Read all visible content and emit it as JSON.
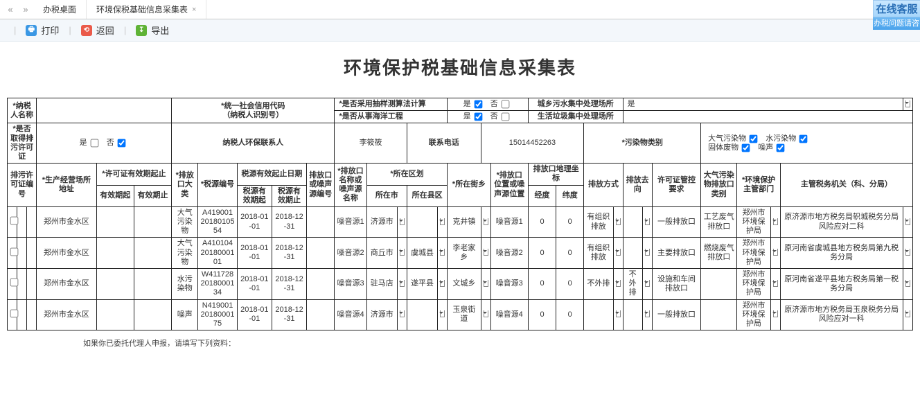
{
  "tabs": {
    "nav_left": "«",
    "nav_right": "»",
    "t0": "办税桌面",
    "t1": "环境保税基础信息采集表",
    "close": "×"
  },
  "toolbar": {
    "print": "打印",
    "back": "返回",
    "export": "导出"
  },
  "online": {
    "top": "在线客服",
    "bot": "办税问题请咨"
  },
  "title": "环境保护税基础信息采集表",
  "hdr": {
    "taxpayer_name": "*纳税人名称",
    "unified_code": "*统一社会信用代码\n（纳税人识别号）",
    "sampling": "*是否采用抽样测算法计算",
    "marine": "*是否从事海洋工程",
    "yes": "是",
    "no": "否",
    "sewage_plant": "城乡污水集中处理场所",
    "sewage_val": "是",
    "waste_plant": "生活垃圾集中处理场所",
    "has_permit": "*是否取得排污许可证",
    "contact_person": "纳税人环保联系人",
    "contact_val": "李筱筱",
    "contact_phone": "联系电话",
    "phone_val": "15014452263",
    "pollutant_cat": "*污染物类别",
    "cat_air": "大气污染物",
    "cat_water": "水污染物",
    "cat_solid": "固体废物",
    "cat_noise": "噪声"
  },
  "cols": {
    "permit_no": "排污许可证编号",
    "prod_addr": "*生产经营场所地址",
    "permit_period": "*许可证有效期起止",
    "start": "有效期起",
    "end": "有效期止",
    "outlet_cat": "*排放口大类",
    "src_no": "*税源编号",
    "src_period": "税源有效起止日期",
    "src_start": "税源有效期起",
    "src_end": "税源有效期止",
    "outlet_src_no": "排放口或噪声源编号",
    "outlet_src_name": "*排放口名称或噪声源名称",
    "region": "*所在区划",
    "city": "所在市",
    "county": "所在县区",
    "town": "*所在街乡",
    "outlet_pos": "*排放口位置或噪声源位置",
    "geo": "排放口地理坐标",
    "lon": "经度",
    "lat": "纬度",
    "mode": "排放方式",
    "dir": "排放去向",
    "permit_req": "许可证管控要求",
    "air_outlet_type": "大气污染物排放口类别",
    "env_dept": "*环境保护主管部门",
    "tax_org": "主管税务机关（科、分局）"
  },
  "rows": [
    {
      "addr": "郑州市金水区",
      "cat": "大气污染物",
      "src": "A4190012018010554",
      "s": "2018-01-01",
      "e": "2018-12-31",
      "name": "噪音源1",
      "city": "济源市",
      "county": "",
      "town": "克井镇",
      "pos": "噪音源1",
      "lon": "0",
      "lat": "0",
      "mode": "有组织排放",
      "dir": "",
      "req": "一般排放口",
      "at": "工艺废气排放口",
      "dept": "郑州市环境保护局",
      "org": "原济源市地方税务局轵城税务分局风险应对二科"
    },
    {
      "addr": "郑州市金水区",
      "cat": "大气污染物",
      "src": "A4101042018000101",
      "s": "2018-01-01",
      "e": "2018-12-31",
      "name": "噪音源2",
      "city": "商丘市",
      "county": "虞城县",
      "town": "李老家乡",
      "pos": "噪音源2",
      "lon": "0",
      "lat": "0",
      "mode": "有组织排放",
      "dir": "",
      "req": "主要排放口",
      "at": "燃烧废气排放口",
      "dept": "郑州市环境保护局",
      "org": "原河南省虞城县地方税务局第九税务分局"
    },
    {
      "addr": "郑州市金水区",
      "cat": "水污染物",
      "src": "W4117282018000134",
      "s": "2018-01-01",
      "e": "2018-12-31",
      "name": "噪音源3",
      "city": "驻马店",
      "county": "遂平县",
      "town": "文城乡",
      "pos": "噪音源3",
      "lon": "0",
      "lat": "0",
      "mode": "不外排",
      "dir": "不外排",
      "req": "设施和车间排放口",
      "at": "",
      "dept": "郑州市环境保护局",
      "org": "原河南省遂平县地方税务局第一税务分局"
    },
    {
      "addr": "郑州市金水区",
      "cat": "噪声",
      "src": "N4190012018000175",
      "s": "2018-01-01",
      "e": "2018-12-31",
      "name": "噪音源4",
      "city": "济源市",
      "county": "",
      "town": "玉泉街道",
      "pos": "噪音源4",
      "lon": "0",
      "lat": "0",
      "mode": "",
      "dir": "",
      "req": "一般排放口",
      "at": "",
      "dept": "郑州市环境保护局",
      "org": "原济源市地方税务局玉泉税务分局风险应对一科"
    }
  ],
  "note": "如果你已委托代理人申报，请填写下列资料："
}
